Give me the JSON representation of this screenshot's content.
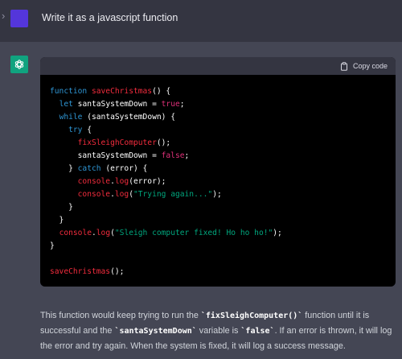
{
  "user": {
    "message": "Write it as a javascript function"
  },
  "code_block": {
    "copy_label": "Copy code",
    "lines": [
      [
        {
          "t": "kw",
          "v": "function "
        },
        {
          "t": "fn",
          "v": "saveChristmas"
        },
        {
          "t": "plain",
          "v": "() {"
        }
      ],
      [
        {
          "t": "plain",
          "v": "  "
        },
        {
          "t": "kw",
          "v": "let"
        },
        {
          "t": "plain",
          "v": " santaSystemDown = "
        },
        {
          "t": "bool",
          "v": "true"
        },
        {
          "t": "plain",
          "v": ";"
        }
      ],
      [
        {
          "t": "plain",
          "v": "  "
        },
        {
          "t": "kw",
          "v": "while"
        },
        {
          "t": "plain",
          "v": " (santaSystemDown) {"
        }
      ],
      [
        {
          "t": "plain",
          "v": "    "
        },
        {
          "t": "kw",
          "v": "try"
        },
        {
          "t": "plain",
          "v": " {"
        }
      ],
      [
        {
          "t": "plain",
          "v": "      "
        },
        {
          "t": "fn",
          "v": "fixSleighComputer"
        },
        {
          "t": "plain",
          "v": "();"
        }
      ],
      [
        {
          "t": "plain",
          "v": "      santaSystemDown = "
        },
        {
          "t": "bool",
          "v": "false"
        },
        {
          "t": "plain",
          "v": ";"
        }
      ],
      [
        {
          "t": "plain",
          "v": "    } "
        },
        {
          "t": "kw",
          "v": "catch"
        },
        {
          "t": "plain",
          "v": " (error) {"
        }
      ],
      [
        {
          "t": "plain",
          "v": "      "
        },
        {
          "t": "fn",
          "v": "console"
        },
        {
          "t": "plain",
          "v": "."
        },
        {
          "t": "fn",
          "v": "log"
        },
        {
          "t": "plain",
          "v": "(error);"
        }
      ],
      [
        {
          "t": "plain",
          "v": "      "
        },
        {
          "t": "fn",
          "v": "console"
        },
        {
          "t": "plain",
          "v": "."
        },
        {
          "t": "fn",
          "v": "log"
        },
        {
          "t": "plain",
          "v": "("
        },
        {
          "t": "str",
          "v": "\"Trying again...\""
        },
        {
          "t": "plain",
          "v": ");"
        }
      ],
      [
        {
          "t": "plain",
          "v": "    }"
        }
      ],
      [
        {
          "t": "plain",
          "v": "  }"
        }
      ],
      [
        {
          "t": "plain",
          "v": "  "
        },
        {
          "t": "fn",
          "v": "console"
        },
        {
          "t": "plain",
          "v": "."
        },
        {
          "t": "fn",
          "v": "log"
        },
        {
          "t": "plain",
          "v": "("
        },
        {
          "t": "str",
          "v": "\"Sleigh computer fixed! Ho ho ho!\""
        },
        {
          "t": "plain",
          "v": ");"
        }
      ],
      [
        {
          "t": "plain",
          "v": "}"
        }
      ],
      [
        {
          "t": "plain",
          "v": ""
        }
      ],
      [
        {
          "t": "fn",
          "v": "saveChristmas"
        },
        {
          "t": "plain",
          "v": "();"
        }
      ]
    ]
  },
  "explanation": {
    "part1": "This function would keep trying to run the ",
    "code1": "`fixSleighComputer()`",
    "part2": " function until it is successful and the ",
    "code2": "`santaSystemDown`",
    "part3": " variable is ",
    "code3": "`false`",
    "part4": ". If an error is thrown, it will log the error and try again. When the system is fixed, it will log a success message."
  },
  "colors": {
    "user_bg": "#343541",
    "assistant_bg": "#444654",
    "user_avatar": "#5436da",
    "gpt_avatar": "#10a37f",
    "code_keyword": "#2e95d3",
    "code_function": "#f22c3d",
    "code_boolean": "#df3079",
    "code_string": "#00a67d"
  },
  "icons": {
    "chevron": "chevron-right-icon",
    "gpt_logo": "openai-logo-icon",
    "copy": "clipboard-icon"
  }
}
